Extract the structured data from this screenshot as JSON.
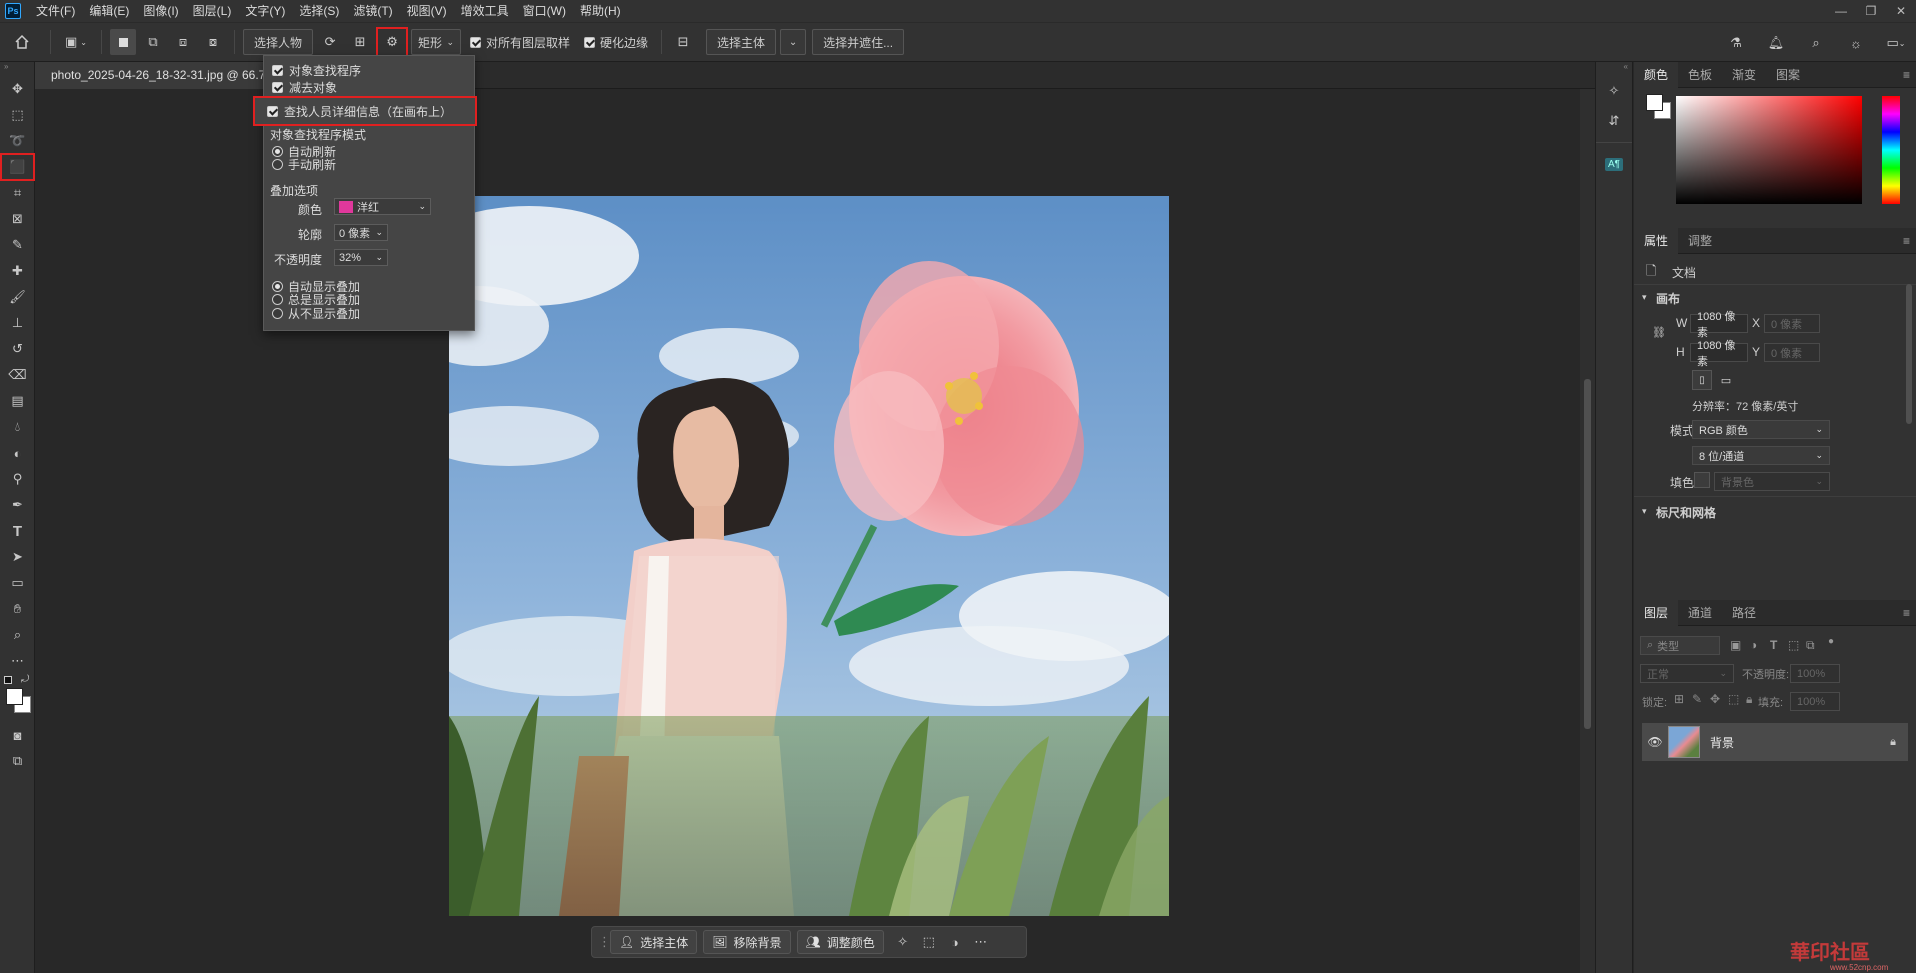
{
  "menu": {
    "items": [
      "文件(F)",
      "编辑(E)",
      "图像(I)",
      "图层(L)",
      "文字(Y)",
      "选择(S)",
      "滤镜(T)",
      "视图(V)",
      "增效工具",
      "窗口(W)",
      "帮助(H)"
    ]
  },
  "options_bar": {
    "select_person": "选择人物",
    "shape": "矩形",
    "sample_all_layers": "对所有图层取样",
    "hard_edge": "硬化边缘",
    "select_subject": "选择主体",
    "select_and_mask": "选择并遮住..."
  },
  "document": {
    "tab_title": "photo_2025-04-26_18-32-31.jpg @ 66.7"
  },
  "dropdown": {
    "object_finder": "对象查找程序",
    "subtract_object": "减去对象",
    "find_person_details": "查找人员详细信息（在画布上）",
    "finder_mode_label": "对象查找程序模式",
    "auto_refresh": "自动刷新",
    "manual_refresh": "手动刷新",
    "overlay_options": "叠加选项",
    "color_label": "颜色",
    "color_value": "洋红",
    "color_hex": "#e0389c",
    "outline_label": "轮廓",
    "outline_value": "0 像素",
    "opacity_label": "不透明度",
    "opacity_value": "32%",
    "auto_show": "自动显示叠加",
    "always_show": "总是显示叠加",
    "never_show": "从不显示叠加"
  },
  "context_bar": {
    "select_subject": "选择主体",
    "remove_bg": "移除背景",
    "adjust_color": "调整颜色"
  },
  "color_panel": {
    "tabs": [
      "颜色",
      "色板",
      "渐变",
      "图案"
    ]
  },
  "properties_panel": {
    "tabs": [
      "属性",
      "调整"
    ],
    "doc_label": "文档",
    "canvas_section": "画布",
    "w_label": "W",
    "w_value": "1080 像素",
    "h_label": "H",
    "h_value": "1080 像素",
    "x_label": "X",
    "x_placeholder": "0 像素",
    "y_label": "Y",
    "y_placeholder": "0 像素",
    "resolution": "分辨率：72 像素/英寸",
    "mode_label": "模式",
    "mode_value": "RGB 颜色",
    "depth_value": "8 位/通道",
    "fill_label": "填色",
    "fill_value": "背景色",
    "rulers_section": "标尺和网格"
  },
  "layers_panel": {
    "tabs": [
      "图层",
      "通道",
      "路径"
    ],
    "filter_label": "类型",
    "blend_mode": "正常",
    "opacity_label": "不透明度:",
    "opacity_value": "100%",
    "lock_label": "锁定:",
    "fill_label": "填充:",
    "fill_value": "100%",
    "layer_name": "背景"
  },
  "watermark": {
    "text": "華印社區",
    "url": "www.52cnp.com"
  }
}
